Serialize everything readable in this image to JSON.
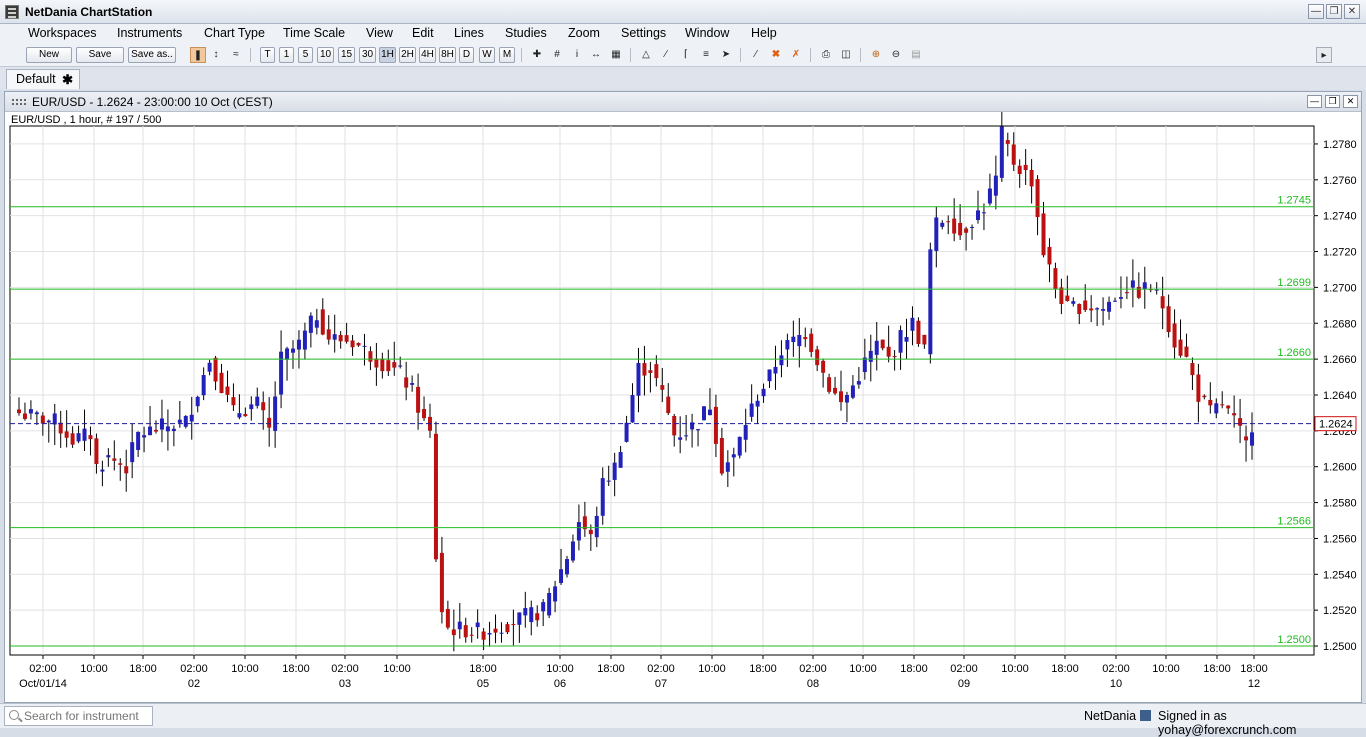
{
  "app": {
    "title": "NetDania ChartStation",
    "window_controls": [
      "minimize-icon",
      "restore-icon",
      "close-icon"
    ]
  },
  "menu": [
    "Workspaces",
    "Instruments",
    "Chart Type",
    "Time Scale",
    "View",
    "Edit",
    "Lines",
    "Studies",
    "Zoom",
    "Settings",
    "Window",
    "Help"
  ],
  "toolbar": {
    "new_label": "New",
    "save_label": "Save",
    "save_as_label": "Save as..",
    "timescale_buttons": [
      "T",
      "1",
      "5",
      "10",
      "15",
      "30",
      "1H",
      "2H",
      "4H",
      "8H",
      "D",
      "W",
      "M"
    ],
    "selected_timescale": "1H"
  },
  "workspace_tab": {
    "label": "Default",
    "close_icon": "close-icon"
  },
  "chart_window": {
    "title": "EUR/USD - 1.2624 - 23:00:00  10 Oct (CEST)",
    "info": "EUR/USD , 1 hour, # 197 / 500",
    "current_price_label": "1.2624"
  },
  "chart_data": {
    "type": "candlestick",
    "symbol": "EUR/USD",
    "interval": "1 hour",
    "y_range": [
      1.2495,
      1.279
    ],
    "y_ticks": [
      "1.2780",
      "1.2760",
      "1.2740",
      "1.2720",
      "1.2700",
      "1.2680",
      "1.2660",
      "1.2640",
      "1.2620",
      "1.2600",
      "1.2580",
      "1.2560",
      "1.2540",
      "1.2520",
      "1.2500"
    ],
    "x_ticks": [
      {
        "time": "02:00",
        "date": "Oct/01/14"
      },
      {
        "time": "10:00",
        "date": ""
      },
      {
        "time": "18:00",
        "date": ""
      },
      {
        "time": "02:00",
        "date": "02"
      },
      {
        "time": "10:00",
        "date": ""
      },
      {
        "time": "18:00",
        "date": ""
      },
      {
        "time": "02:00",
        "date": "03"
      },
      {
        "time": "10:00",
        "date": ""
      },
      {
        "time": "18:00",
        "date": "05"
      },
      {
        "time": "10:00",
        "date": "06"
      },
      {
        "time": "18:00",
        "date": ""
      },
      {
        "time": "02:00",
        "date": "07"
      },
      {
        "time": "10:00",
        "date": ""
      },
      {
        "time": "18:00",
        "date": ""
      },
      {
        "time": "02:00",
        "date": "08"
      },
      {
        "time": "10:00",
        "date": ""
      },
      {
        "time": "18:00",
        "date": ""
      },
      {
        "time": "02:00",
        "date": "09"
      },
      {
        "time": "10:00",
        "date": ""
      },
      {
        "time": "18:00",
        "date": ""
      },
      {
        "time": "02:00",
        "date": "10"
      },
      {
        "time": "10:00",
        "date": ""
      },
      {
        "time": "18:00",
        "date": ""
      },
      {
        "time": "18:00",
        "date": "12"
      }
    ],
    "horizontal_lines": [
      {
        "label": "1.2745",
        "value": 1.2745,
        "color": "#22bb22"
      },
      {
        "label": "1.2699",
        "value": 1.2699,
        "color": "#22bb22"
      },
      {
        "label": "1.2660",
        "value": 1.266,
        "color": "#22bb22"
      },
      {
        "label": "1.2566",
        "value": 1.2566,
        "color": "#22bb22"
      },
      {
        "label": "1.2500",
        "value": 1.25,
        "color": "#22bb22"
      }
    ],
    "current_price": 1.2624,
    "up_color": "#2222bb",
    "down_color": "#bb1111",
    "grid": true,
    "anchors": [
      [
        0,
        1.263
      ],
      [
        6,
        1.2625
      ],
      [
        9,
        1.2615
      ],
      [
        12,
        1.2618
      ],
      [
        13,
        1.26
      ],
      [
        15,
        1.2605
      ],
      [
        18,
        1.26
      ],
      [
        20,
        1.2618
      ],
      [
        24,
        1.2622
      ],
      [
        28,
        1.2625
      ],
      [
        32,
        1.266
      ],
      [
        36,
        1.263
      ],
      [
        40,
        1.2635
      ],
      [
        42,
        1.262
      ],
      [
        44,
        1.266
      ],
      [
        47,
        1.2668
      ],
      [
        50,
        1.2685
      ],
      [
        52,
        1.2672
      ],
      [
        56,
        1.267
      ],
      [
        60,
        1.266
      ],
      [
        64,
        1.2652
      ],
      [
        66,
        1.2642
      ],
      [
        68,
        1.2625
      ],
      [
        69,
        1.2618
      ],
      [
        70,
        1.255
      ],
      [
        71,
        1.252
      ],
      [
        72,
        1.251
      ],
      [
        78,
        1.2508
      ],
      [
        84,
        1.2515
      ],
      [
        88,
        1.252
      ],
      [
        90,
        1.2535
      ],
      [
        92,
        1.255
      ],
      [
        94,
        1.257
      ],
      [
        96,
        1.256
      ],
      [
        98,
        1.259
      ],
      [
        100,
        1.26
      ],
      [
        102,
        1.2625
      ],
      [
        104,
        1.2655
      ],
      [
        106,
        1.2655
      ],
      [
        108,
        1.264
      ],
      [
        110,
        1.2618
      ],
      [
        112,
        1.262
      ],
      [
        114,
        1.2625
      ],
      [
        116,
        1.2635
      ],
      [
        118,
        1.26
      ],
      [
        120,
        1.2605
      ],
      [
        122,
        1.2625
      ],
      [
        124,
        1.264
      ],
      [
        126,
        1.265
      ],
      [
        128,
        1.2665
      ],
      [
        130,
        1.267
      ],
      [
        132,
        1.2675
      ],
      [
        134,
        1.266
      ],
      [
        136,
        1.2645
      ],
      [
        138,
        1.2635
      ],
      [
        140,
        1.2645
      ],
      [
        142,
        1.2658
      ],
      [
        144,
        1.2668
      ],
      [
        146,
        1.266
      ],
      [
        148,
        1.2672
      ],
      [
        150,
        1.268
      ],
      [
        152,
        1.2665
      ],
      [
        153,
        1.272
      ],
      [
        154,
        1.2735
      ],
      [
        156,
        1.274
      ],
      [
        158,
        1.273
      ],
      [
        160,
        1.2738
      ],
      [
        162,
        1.2745
      ],
      [
        164,
        1.276
      ],
      [
        165,
        1.2785
      ],
      [
        167,
        1.277
      ],
      [
        170,
        1.276
      ],
      [
        172,
        1.272
      ],
      [
        174,
        1.27
      ],
      [
        176,
        1.2688
      ],
      [
        178,
        1.269
      ],
      [
        182,
        1.2688
      ],
      [
        184,
        1.2695
      ],
      [
        186,
        1.27
      ],
      [
        188,
        1.2698
      ],
      [
        190,
        1.27
      ],
      [
        192,
        1.269
      ],
      [
        194,
        1.267
      ],
      [
        196,
        1.266
      ],
      [
        198,
        1.264
      ],
      [
        200,
        1.263
      ],
      [
        202,
        1.2635
      ],
      [
        204,
        1.2625
      ],
      [
        206,
        1.2612
      ],
      [
        207,
        1.2624
      ]
    ]
  },
  "statusbar": {
    "search_placeholder": "Search for instrument",
    "brand": "NetDania",
    "signed_in": "Signed in as yohay@forexcrunch.com"
  }
}
